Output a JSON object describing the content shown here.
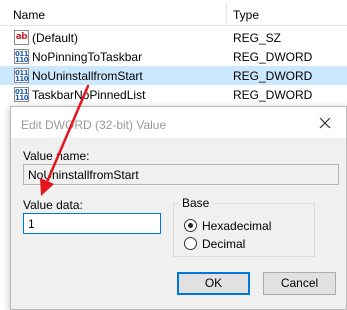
{
  "registry": {
    "columns": {
      "name": "Name",
      "type": "Type"
    },
    "rows": [
      {
        "icon": "string-value-icon",
        "icon_glyph": "ab",
        "name": "(Default)",
        "type": "REG_SZ"
      },
      {
        "icon": "dword-value-icon",
        "icon_glyph": "011 110",
        "name": "NoPinningToTaskbar",
        "type": "REG_DWORD"
      },
      {
        "icon": "dword-value-icon",
        "icon_glyph": "011 110",
        "name": "NoUninstallfromStart",
        "type": "REG_DWORD"
      },
      {
        "icon": "dword-value-icon",
        "icon_glyph": "011 110",
        "name": "TaskbarNoPinnedList",
        "type": "REG_DWORD"
      }
    ]
  },
  "dialog": {
    "title": "Edit DWORD (32-bit) Value",
    "value_name_label": "Value name:",
    "value_name": "NoUninstallfromStart",
    "value_data_label": "Value data:",
    "value_data": "1",
    "base_label": "Base",
    "base_options": [
      "Hexadecimal",
      "Decimal"
    ],
    "base_selected": "Hexadecimal",
    "ok_label": "OK",
    "cancel_label": "Cancel"
  },
  "colors": {
    "selection": "#cce8ff",
    "annotation_arrow": "#e2161c",
    "focus_border": "#0078d7"
  }
}
